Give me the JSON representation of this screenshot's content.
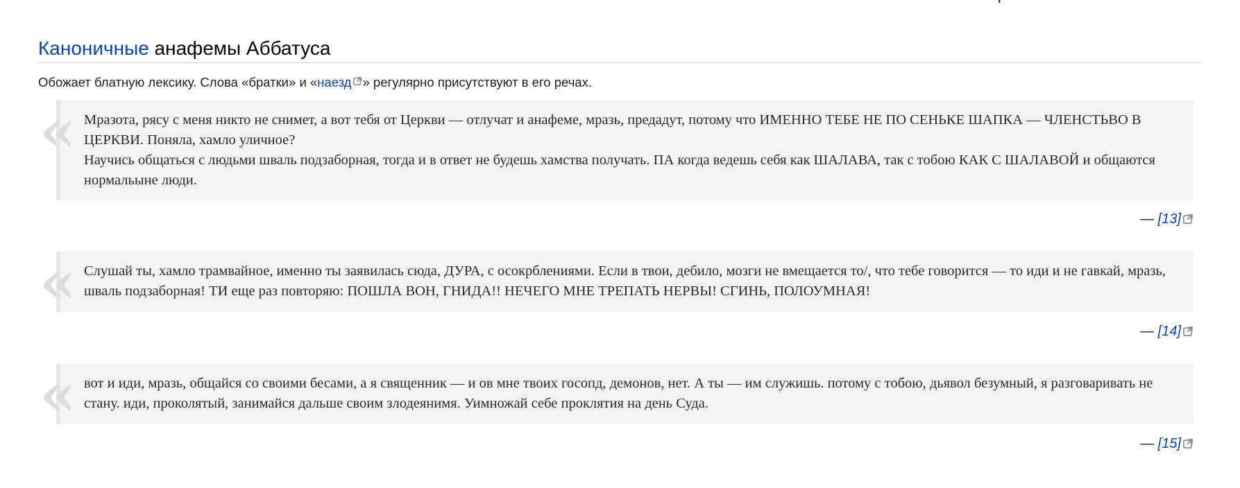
{
  "top_fragment": "[",
  "section": {
    "title_link": "Каноничные",
    "title_rest": " анафемы Аббатуса"
  },
  "intro": {
    "part1": "Обожает блатную лексику. Слова «братки» и «",
    "link": "наезд",
    "part2": "» регулярно присутствуют в его речах."
  },
  "quote_mark": "«",
  "quotes": [
    {
      "lines": [
        "Мразота, рясу с меня никто не снимет, а вот тебя от Церкви — отлучат и анафеме, мразь, предадут, потому что ИМЕННО ТЕБЕ НЕ ПО СЕНЬКЕ ШАПКА — ЧЛЕНСТЬВО В ЦЕРКВИ. Поняла, хамло уличное?",
        "Научись общаться с людьми шваль подзаборная, тогда и в ответ не будешь хамства получать. ПА когда ведешь себя как ШАЛАВА, так с тобою КАК С ШАЛАВОЙ и общаются нормальыне люди."
      ],
      "cite_dash": "— ",
      "cite_label": "[13]"
    },
    {
      "lines": [
        "Слушай ты, хамло трамвайное, именно ты заявилась сюда, ДУРА, с осокрблениями. Если в твои, дебило, мозги не вмещается то/, что тебе говорится — то иди и не гавкай, мразь, шваль подзаборная! ТИ еще раз повторяю: ПОШЛА ВОН, ГНИДА!! НЕЧЕГО МНЕ ТРЕПАТЬ НЕРВЫ! СГИНЬ, ПОЛОУМНАЯ!"
      ],
      "cite_dash": "— ",
      "cite_label": "[14]"
    },
    {
      "lines": [
        "вот и иди, мразь, общайся со своими бесами, а я священник — и ов мне твоих госопд, демонов, нет. А ты — им служишь. потому с тобою, дьявол безумный, я разговаривать не стану. иди, проколятый, занимайся дальше своим злодеянимя. Уимножай себе проклятия на день Суда."
      ],
      "cite_dash": "— ",
      "cite_label": "[15]"
    }
  ]
}
